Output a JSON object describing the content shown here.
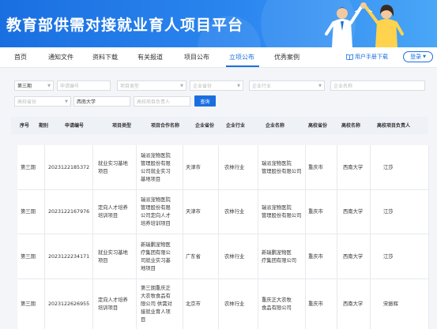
{
  "header": {
    "title": "教育部供需对接就业育人项目平台"
  },
  "nav": {
    "items": [
      "首页",
      "通知文件",
      "资料下载",
      "有关报道",
      "项目公布",
      "立项公布",
      "优秀案例"
    ],
    "active_index": 5,
    "manual_label": "用户手册下载",
    "login_label": "登录"
  },
  "filters": {
    "batch": "第三期",
    "application_no_placeholder": "申请编号",
    "project_type_placeholder": "项目类型",
    "company_province_placeholder": "企业省份",
    "company_industry_placeholder": "企业行业",
    "company_name_placeholder": "企业名称",
    "school_province_placeholder": "高校省份",
    "school_name": "西南大学",
    "leader_placeholder": "高校项目负责人",
    "query_label": "查询"
  },
  "table": {
    "headers": [
      "序号",
      "期别",
      "申请编号",
      "项目类型",
      "项目合作名称",
      "企业省份",
      "企业行业",
      "企业名称",
      "高校省份",
      "高校名称",
      "高校项目负责人"
    ],
    "rows": [
      {
        "period": "第三期",
        "app_no": "2023122185372",
        "type_lines": [
          "就业实习基地",
          "项目"
        ],
        "name_lines": [
          "瑞派宠物医院",
          "管理股份有限",
          "公司就业实习",
          "基地项目"
        ],
        "province": "天津市",
        "industry": "农林行业",
        "company_lines": [
          "瑞派宠物医院",
          "管理股份有限公司"
        ],
        "school_province": "重庆市",
        "school": "西南大学",
        "leader": "江莎"
      },
      {
        "period": "第三期",
        "app_no": "2023122167976",
        "type_lines": [
          "定向人才培养",
          "培训项目"
        ],
        "name_lines": [
          "瑞派宠物医院",
          "管理股份有限",
          "公司定向人才",
          "培养培训项目"
        ],
        "province": "天津市",
        "industry": "农林行业",
        "company_lines": [
          "瑞派宠物医院",
          "管理股份有限公司"
        ],
        "school_province": "重庆市",
        "school": "西南大学",
        "leader": "江莎"
      },
      {
        "period": "第三期",
        "app_no": "2023122234171",
        "type_lines": [
          "就业实习基地",
          "项目"
        ],
        "name_lines": [
          "新瑞鹏宠物医",
          "疗集团有限公",
          "司就业实习基",
          "地项目"
        ],
        "province": "广东省",
        "industry": "农林行业",
        "company_lines": [
          "新瑞鹏宠物医",
          "疗集团有限公司"
        ],
        "school_province": "重庆市",
        "school": "西南大学",
        "leader": "江莎"
      },
      {
        "period": "第三期",
        "app_no": "2023122626955",
        "type_lines": [
          "定向人才培养",
          "培训项目"
        ],
        "name_lines": [
          "第三期重庆正",
          "大农牧食品有",
          "限公司 供需对",
          "接就业育人项",
          "目"
        ],
        "province": "北京市",
        "industry": "农林行业",
        "company_lines": [
          "重庆正大农牧",
          "食品有限公司"
        ],
        "school_province": "重庆市",
        "school": "西南大学",
        "leader": "宋振辉"
      }
    ]
  },
  "colors": {
    "primary": "#1a6fe0",
    "banner_light": "#4aa6f6",
    "border": "#e6e9ee"
  }
}
